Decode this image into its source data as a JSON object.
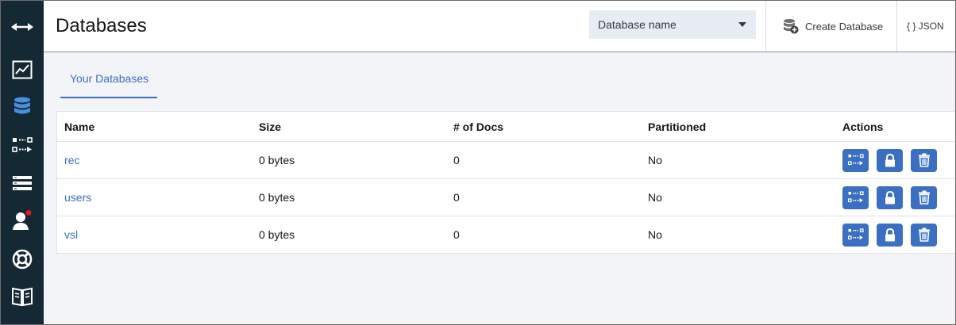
{
  "sidebar": {
    "items": [
      {
        "name": "expand",
        "icon": "expand-arrows-icon"
      },
      {
        "name": "active-tasks",
        "icon": "line-chart-icon"
      },
      {
        "name": "databases",
        "icon": "database-icon",
        "active": true
      },
      {
        "name": "replication",
        "icon": "replication-icon"
      },
      {
        "name": "setup",
        "icon": "server-stack-icon"
      },
      {
        "name": "user",
        "icon": "user-icon",
        "notification": true
      },
      {
        "name": "support",
        "icon": "lifebuoy-icon"
      },
      {
        "name": "documentation",
        "icon": "book-icon"
      }
    ]
  },
  "header": {
    "title": "Databases",
    "db_select_placeholder": "Database name",
    "create_label": "Create Database",
    "json_label": "{ } JSON"
  },
  "tabs": [
    {
      "label": "Your Databases",
      "active": true
    }
  ],
  "table": {
    "headers": [
      "Name",
      "Size",
      "# of Docs",
      "Partitioned",
      "Actions"
    ],
    "rows": [
      {
        "name": "rec",
        "size": "0 bytes",
        "docs": "0",
        "partitioned": "No"
      },
      {
        "name": "users",
        "size": "0 bytes",
        "docs": "0",
        "partitioned": "No"
      },
      {
        "name": "vsl",
        "size": "0 bytes",
        "docs": "0",
        "partitioned": "No"
      }
    ],
    "action_icons": [
      "replicate-icon",
      "lock-icon",
      "trash-icon"
    ]
  },
  "colors": {
    "sidebar": "#152935",
    "accent": "#3b6fc1",
    "active_nav": "#4b8fe0",
    "notification": "#e0182d"
  }
}
